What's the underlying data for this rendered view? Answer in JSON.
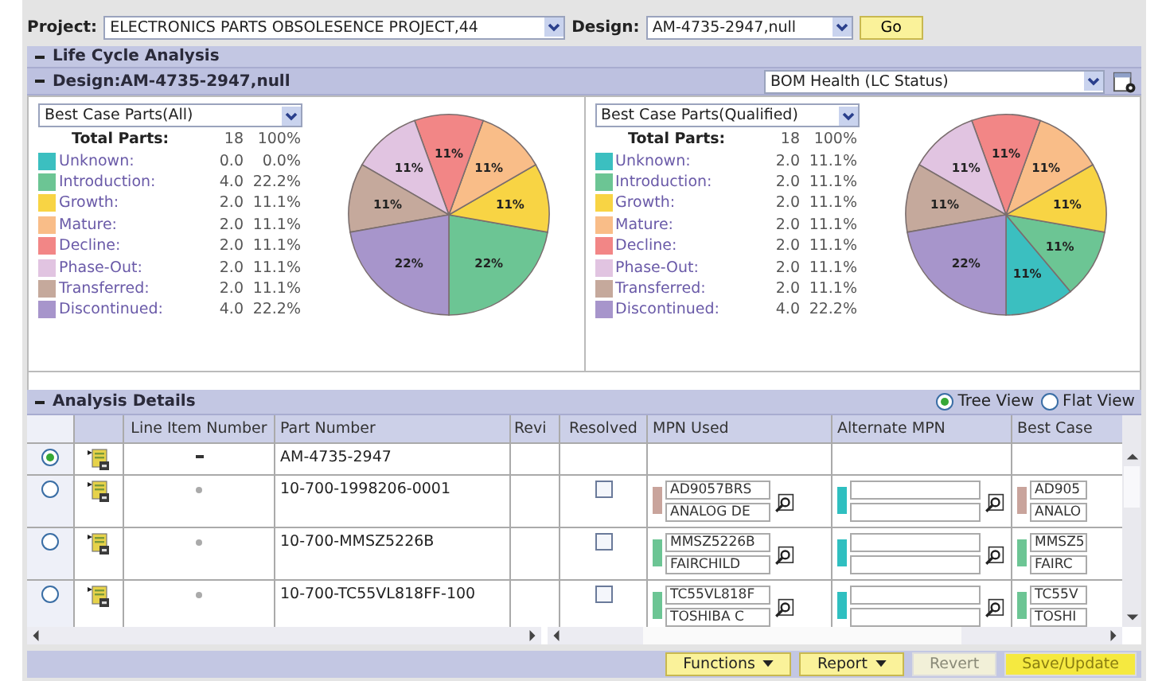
{
  "toolbar": {
    "project_label": "Project:",
    "project": "ELECTRONICS PARTS OBSOLESENCE PROJECT,44",
    "design_label": "Design:",
    "design": "AM-4735-2947,null",
    "go": "Go"
  },
  "lifecycle": {
    "title": "Life Cycle Analysis",
    "design_title": "Design:AM-4735-2947,null",
    "view": "BOM Health (LC Status)",
    "panels": [
      {
        "filter": "Best Case Parts(All)",
        "total_label": "Total Parts:",
        "total_count": "18",
        "total_pct": "100%",
        "legend": [
          {
            "name": "Unknown:",
            "count": "0.0",
            "pct": "0.0%",
            "color": "#3bbfc0"
          },
          {
            "name": "Introduction:",
            "count": "4.0",
            "pct": "22.2%",
            "color": "#6cc594"
          },
          {
            "name": "Growth:",
            "count": "2.0",
            "pct": "11.1%",
            "color": "#f8d444"
          },
          {
            "name": "Mature:",
            "count": "2.0",
            "pct": "11.1%",
            "color": "#f9bd88"
          },
          {
            "name": "Decline:",
            "count": "2.0",
            "pct": "11.1%",
            "color": "#f28686"
          },
          {
            "name": "Phase-Out:",
            "count": "2.0",
            "pct": "11.1%",
            "color": "#e1c4e1"
          },
          {
            "name": "Transferred:",
            "count": "2.0",
            "pct": "11.1%",
            "color": "#c5a99c"
          },
          {
            "name": "Discontinued:",
            "count": "4.0",
            "pct": "22.2%",
            "color": "#a795cb"
          }
        ],
        "chart_data": {
          "type": "pie",
          "values": [
            0,
            22,
            11,
            11,
            11,
            11,
            11,
            22
          ],
          "value_labels": [
            null,
            "22%",
            "11%",
            "11%",
            "11%",
            "11%",
            "11%",
            "22%"
          ]
        }
      },
      {
        "filter": "Best Case Parts(Qualified)",
        "total_label": "Total Parts:",
        "total_count": "18",
        "total_pct": "100%",
        "legend": [
          {
            "name": "Unknown:",
            "count": "2.0",
            "pct": "11.1%",
            "color": "#3bbfc0"
          },
          {
            "name": "Introduction:",
            "count": "2.0",
            "pct": "11.1%",
            "color": "#6cc594"
          },
          {
            "name": "Growth:",
            "count": "2.0",
            "pct": "11.1%",
            "color": "#f8d444"
          },
          {
            "name": "Mature:",
            "count": "2.0",
            "pct": "11.1%",
            "color": "#f9bd88"
          },
          {
            "name": "Decline:",
            "count": "2.0",
            "pct": "11.1%",
            "color": "#f28686"
          },
          {
            "name": "Phase-Out:",
            "count": "2.0",
            "pct": "11.1%",
            "color": "#e1c4e1"
          },
          {
            "name": "Transferred:",
            "count": "2.0",
            "pct": "11.1%",
            "color": "#c5a99c"
          },
          {
            "name": "Discontinued:",
            "count": "4.0",
            "pct": "22.2%",
            "color": "#a795cb"
          }
        ],
        "chart_data": {
          "type": "pie",
          "values": [
            11,
            11,
            11,
            11,
            11,
            11,
            11,
            22
          ],
          "value_labels": [
            "11%",
            "11%",
            "11%",
            "11%",
            "11%",
            "11%",
            "11%",
            "22%"
          ]
        }
      }
    ]
  },
  "analysis": {
    "title": "Analysis Details",
    "views": [
      {
        "label": "Tree View",
        "selected": true
      },
      {
        "label": "Flat View",
        "selected": false
      }
    ],
    "columns": [
      "Line Item Number",
      "Part Number",
      "Revi",
      "Resolved",
      "MPN Used",
      "Alternate MPN",
      "Best Case"
    ],
    "rows": [
      {
        "kind": "assembly",
        "selected": true,
        "part": "AM-4735-2947"
      },
      {
        "kind": "part",
        "selected": false,
        "part": "10-700-1998206-0001",
        "resolved": false,
        "mpn": {
          "part": "AD9057BRS",
          "maker": "ANALOG DE",
          "color": "#c9a49c"
        },
        "alternate": {
          "color": "#2fbfc0"
        },
        "best_case": {
          "part": "AD905",
          "maker": "ANALO",
          "color": "#c9a49c"
        }
      },
      {
        "kind": "part",
        "selected": false,
        "part": "10-700-MMSZ5226B",
        "resolved": false,
        "mpn": {
          "part": "MMSZ5226B",
          "maker": "FAIRCHILD",
          "color": "#6cc594"
        },
        "alternate": {
          "color": "#2fbfc0"
        },
        "best_case": {
          "part": "MMSZ5",
          "maker": "FAIRC",
          "color": "#6cc594"
        }
      },
      {
        "kind": "part",
        "selected": false,
        "part": "10-700-TC55VL818FF-100",
        "resolved": false,
        "mpn": {
          "part": "TC55VL818F",
          "maker": "TOSHIBA C",
          "color": "#6cc594"
        },
        "alternate": {
          "color": "#2fbfc0"
        },
        "best_case": {
          "part": "TC55V",
          "maker": "TOSHI",
          "color": "#6cc594"
        }
      }
    ]
  },
  "footer": {
    "buttons": [
      {
        "label": "Functions",
        "kind": "menu",
        "disabled": false
      },
      {
        "label": "Report",
        "kind": "menu",
        "disabled": false
      },
      {
        "label": "Revert",
        "kind": "plain",
        "disabled": true
      },
      {
        "label": "Save/Update",
        "kind": "primary",
        "disabled": true
      }
    ]
  }
}
